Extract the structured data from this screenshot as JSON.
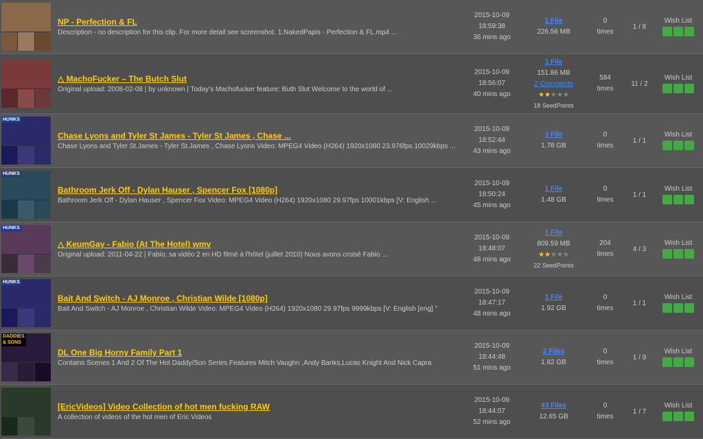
{
  "items": [
    {
      "id": 1,
      "title": "NP - Perfection & FL",
      "title_full": "NP - Perfection & FL",
      "desc": "Description - no description for this clip. For more detail see screenshot. 1.NakedPapis - Perfection & FL.mp4 ...",
      "date": "2015-10-09",
      "time": "18:59:38",
      "ago": "36 mins ago",
      "file_count": "1 File",
      "file_size": "226.56 MB",
      "times_val": "0",
      "times_label": "times",
      "pages": "1 / 8",
      "wishlist": "Wish List",
      "has_comments": false,
      "comments": "",
      "has_stars": false,
      "seedpoints": "",
      "thumb_type": "naked"
    },
    {
      "id": 2,
      "title": "△ MachoFucker – The Butch Slut",
      "title_full": "△ MachoFucker – The Butch Slut",
      "desc": "Original upload: 2008-02-08 | by unknown | Today's Machofucker feature: Buth Slut Welcome to the world of ...",
      "date": "2015-10-09",
      "time": "18:56:07",
      "ago": "40 mins ago",
      "file_count": "1 File",
      "file_size": "151.86 MB",
      "times_val": "584",
      "times_label": "times",
      "pages": "11 / 2",
      "wishlist": "Wish List",
      "has_comments": true,
      "comments": "2 Comments",
      "has_stars": true,
      "stars": 2,
      "max_stars": 5,
      "seedpoints": "18 SeedPoints",
      "thumb_type": "macho"
    },
    {
      "id": 3,
      "title": "Chase Lyons and Tyler St James - Tyler St James , Chase ...",
      "title_full": "Chase Lyons and Tyler St James - Tyler St James , Chase ...",
      "desc": "Chase Lyons and Tyler St.James - Tyler St.James , Chase Lyons Video: MPEG4 Video (H264) 1920x1080 23.976fps 10029kbps ...",
      "date": "2015-10-09",
      "time": "18:52:44",
      "ago": "43 mins ago",
      "file_count": "1 File",
      "file_size": "1.78 GB",
      "times_val": "0",
      "times_label": "times",
      "pages": "1 / 1",
      "wishlist": "Wish List",
      "has_comments": false,
      "comments": "",
      "has_stars": false,
      "seedpoints": "",
      "thumb_type": "hunks"
    },
    {
      "id": 4,
      "title": "Bathroom Jerk Off - Dylan Hauser , Spencer Fox [1080p]",
      "title_full": "Bathroom Jerk Off - Dylan Hauser , Spencer Fox [1080p]",
      "desc": "Bathroom Jerk Off - Dylan Hauser , Spencer Fox Video: MPEG4 Video (H264) 1920x1080 29.97fps 10001kbps [V: English ...",
      "date": "2015-10-09",
      "time": "18:50:24",
      "ago": "45 mins ago",
      "file_count": "1 File",
      "file_size": "1.48 GB",
      "times_val": "0",
      "times_label": "times",
      "pages": "1 / 1",
      "wishlist": "Wish List",
      "has_comments": false,
      "comments": "",
      "has_stars": false,
      "seedpoints": "",
      "thumb_type": "bathroom"
    },
    {
      "id": 5,
      "title": "△ KeumGay - Fabio (At The Hotel) wmv",
      "title_full": "△ KeumGay - Fabio (At The Hotel) wmv",
      "desc": "Original upload: 2011-04-22 | Fabio, sa vidéo 2 en HD filmé à l'hôtel (juillet 2010) Nous avons croisé Fabio ...",
      "date": "2015-10-09",
      "time": "18:48:07",
      "ago": "48 mins ago",
      "file_count": "1 File",
      "file_size": "809.59 MB",
      "times_val": "204",
      "times_label": "times",
      "pages": "4 / 3",
      "wishlist": "Wish List",
      "has_comments": false,
      "comments": "",
      "has_stars": true,
      "stars": 2,
      "max_stars": 5,
      "seedpoints": "22 SeedPoints",
      "thumb_type": "keum"
    },
    {
      "id": 6,
      "title": "Bait And Switch - AJ Monroe , Christian Wilde [1080p]",
      "title_full": "Bait And Switch - AJ Monroe , Christian Wilde [1080p]",
      "desc": "Bait And Switch - AJ Monroe , Christian Wilde Video: MPEG4 Video (H264) 1920x1080 29.97fps 9999kbps [V: English [eng] \"",
      "date": "2015-10-09",
      "time": "18:47:17",
      "ago": "48 mins ago",
      "file_count": "1 File",
      "file_size": "1.92 GB",
      "times_val": "0",
      "times_label": "times",
      "pages": "1 / 1",
      "wishlist": "Wish List",
      "has_comments": false,
      "comments": "",
      "has_stars": false,
      "seedpoints": "",
      "thumb_type": "hunks"
    },
    {
      "id": 7,
      "title": "DL One Big Horny Family Part 1",
      "title_full": "DL One Big Horny Family Part 1",
      "desc": "Contains Scenes 1 And 2 Of The Hot Daddy/Son Series.Features Mitch Vaughn ,Andy Banks,Lucas Knight And Nick Capra",
      "date": "2015-10-09",
      "time": "18:44:48",
      "ago": "51 mins ago",
      "file_count": "2 Files",
      "file_size": "1.82 GB",
      "times_val": "0",
      "times_label": "times",
      "pages": "1 / 9",
      "wishlist": "Wish List",
      "has_comments": false,
      "comments": "",
      "has_stars": false,
      "seedpoints": "",
      "thumb_type": "daddies"
    },
    {
      "id": 8,
      "title": "[EricVideos] Video Collection of hot men fucking RAW",
      "title_full": "[EricVideos] Video Collection of hot men fucking RAW",
      "desc": "A collection of videos of the hot men of Eric Videos",
      "date": "2015-10-09",
      "time": "18:44:07",
      "ago": "52 mins ago",
      "file_count": "43 Files",
      "file_size": "12.65 GB",
      "times_val": "0",
      "times_label": "times",
      "pages": "1 / 7",
      "wishlist": "Wish List",
      "has_comments": false,
      "comments": "",
      "has_stars": false,
      "seedpoints": "",
      "thumb_type": "eric"
    }
  ],
  "colors": {
    "accent": "#ffcc00",
    "link": "#4488ff",
    "bg_odd": "#5a5a5a",
    "bg_even": "#4e4e4e",
    "text_muted": "#cccccc",
    "btn_green": "#44aa44"
  }
}
